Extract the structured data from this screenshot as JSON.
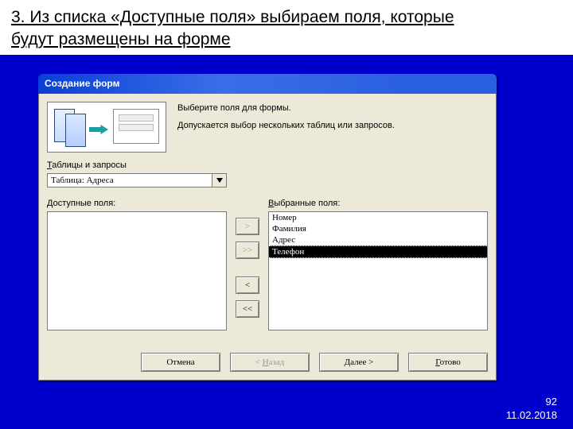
{
  "slide": {
    "heading_line1": "3. Из списка «Доступные поля» выбираем поля, которые",
    "heading_line2": "будут размещены на форме",
    "page_number": "92",
    "date": "11.02.2018"
  },
  "dialog": {
    "title": "Создание форм",
    "banner": {
      "line1": "Выберите поля для формы.",
      "line2": "Допускается выбор нескольких таблиц или запросов."
    },
    "tables_label_u": "Т",
    "tables_label_rest": "аблицы и запросы",
    "tables_combo_value": "Таблица: Адреса",
    "available_label_u": "Д",
    "available_label_rest": "оступные поля:",
    "selected_label_u": "В",
    "selected_label_rest": "ыбранные поля:",
    "selected_fields": [
      "Номер",
      "Фамилия",
      "Адрес",
      "Телефон"
    ],
    "selected_index": 3,
    "buttons": {
      "move_right": ">",
      "move_all_right": ">>",
      "move_left": "<",
      "move_all_left": "<<",
      "cancel": "Отмена",
      "back_u": "Н",
      "back_pre": "< ",
      "back_rest": "азад",
      "next_u": "Д",
      "next_rest": "алее >",
      "finish_u": "Г",
      "finish_rest": "отово"
    }
  }
}
